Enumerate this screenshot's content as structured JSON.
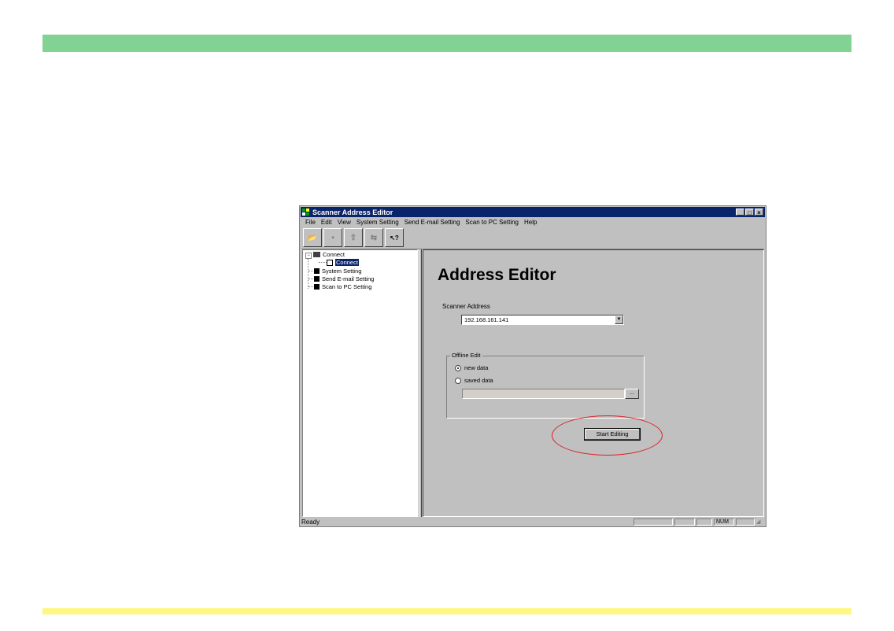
{
  "window": {
    "title": "Scanner Address Editor",
    "controls": {
      "minimize": "_",
      "maximize": "□",
      "close": "×"
    }
  },
  "menu": [
    "File",
    "Edit",
    "View",
    "System Setting",
    "Send E-mail Setting",
    "Scan to PC Setting",
    "Help"
  ],
  "toolbar": {
    "buttons": [
      {
        "icon": "open-folder-icon",
        "glyph": "📂",
        "enabled": true
      },
      {
        "icon": "save-icon",
        "glyph": "▪",
        "enabled": false
      },
      {
        "icon": "upload-icon",
        "glyph": "⇧",
        "enabled": false
      },
      {
        "icon": "transfer-icon",
        "glyph": "⇆",
        "enabled": false
      },
      {
        "icon": "help-pointer-icon",
        "glyph": "↖?",
        "enabled": true
      }
    ]
  },
  "tree": {
    "root": "Connect",
    "root_child": "Connect",
    "items": [
      "System Setting",
      "Send E-mail Setting",
      "Scan to PC Setting"
    ]
  },
  "main": {
    "heading": "Address Editor",
    "scanner_address_label": "Scanner Address",
    "scanner_address_value": "192.168.161.141",
    "offline_group_title": "Offline Edit",
    "radio_new": "new data",
    "radio_saved": "saved data",
    "browse_label": "...",
    "start_button": "Start Editing"
  },
  "status": {
    "message": "Ready",
    "num": "NUM"
  },
  "colors": {
    "top_band": "#82d393",
    "bottom_band": "#fdf784",
    "title_bar": "#0a246a",
    "highlight_ellipse": "#dc1e28"
  }
}
